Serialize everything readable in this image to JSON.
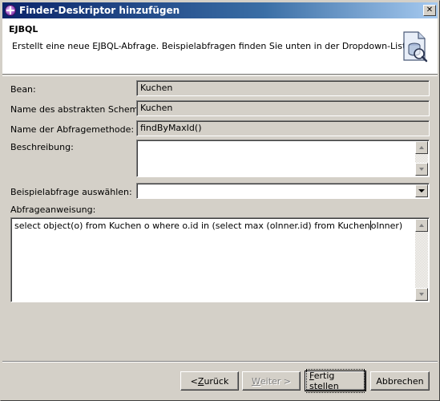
{
  "window": {
    "title": "Finder-Deskriptor hinzufügen",
    "close_symbol": "✕"
  },
  "header": {
    "title": "EJBQL",
    "description": "Erstellt eine neue EJBQL-Abfrage.  Beispielabfragen finden Sie unten in der Dropdown-Liste.",
    "icon": "wizard-finder-icon"
  },
  "form": {
    "bean_label": "Bean:",
    "bean_value": "Kuchen",
    "schema_label": "Name des abstrakten Schemas:",
    "schema_value": "Kuchen",
    "method_label": "Name der Abfragemethode:",
    "method_value": "findByMaxId()",
    "description_label": "Beschreibung:",
    "description_value": "",
    "example_label": "Beispielabfrage auswählen:",
    "example_value": "",
    "statement_label": "Abfrageanweisung:",
    "statement_before_caret": "select object(o) from Kuchen o where  o.id in (select max (oInner.id) from Kuchen",
    "statement_after_caret": "oInner)"
  },
  "buttons": {
    "back_prefix": "< ",
    "back_mnemonic": "Z",
    "back_rest": "urück",
    "next_mnemonic": "W",
    "next_rest": "eiter >",
    "finish_mnemonic": "F",
    "finish_rest": "ertig stellen",
    "cancel_label": "Abbrechen"
  },
  "colors": {
    "titlebar_start": "#0a246a",
    "titlebar_end": "#a6caf0",
    "dialog_bg": "#d4d0c8"
  }
}
